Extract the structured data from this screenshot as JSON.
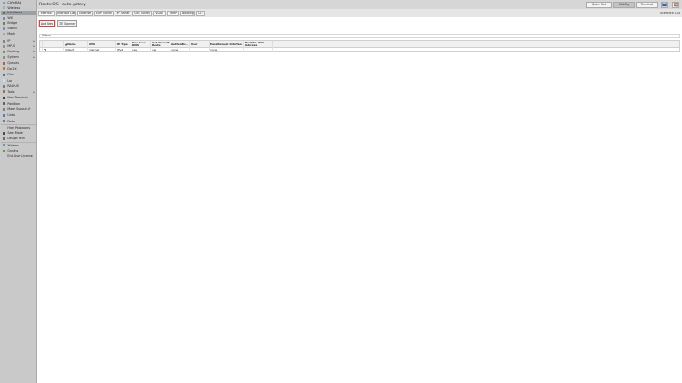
{
  "app": {
    "title": "RouterOS · auto.yotasy"
  },
  "topbar": {
    "quick_set": "Quick Set",
    "webfig": "WebFig",
    "terminal": "Terminal"
  },
  "sidebar": {
    "items": [
      {
        "label": "CAPsMAN"
      },
      {
        "label": "Wireless"
      },
      {
        "label": "Interfaces"
      },
      {
        "label": "WiFi"
      },
      {
        "label": "Bridge"
      },
      {
        "label": "Switch"
      },
      {
        "label": "Mesh"
      },
      {
        "label": "IP"
      },
      {
        "label": "MPLS"
      },
      {
        "label": "Routing"
      },
      {
        "label": "System"
      },
      {
        "label": "Queues"
      },
      {
        "label": "Dot1X"
      },
      {
        "label": "Files"
      },
      {
        "label": "Log"
      },
      {
        "label": "RADIUS"
      },
      {
        "label": "Tools"
      },
      {
        "label": "New Terminal"
      },
      {
        "label": "Partition"
      },
      {
        "label": "Make Supout.rif"
      },
      {
        "label": "Undo"
      },
      {
        "label": "Redo"
      },
      {
        "label": "Hide Passwords"
      },
      {
        "label": "Safe Mode"
      },
      {
        "label": "Design Skin"
      },
      {
        "label": "Winbox"
      },
      {
        "label": "Graphs"
      },
      {
        "label": "End-User License"
      }
    ]
  },
  "tabs": [
    "Interface",
    "Interface List",
    "Ethernet",
    "EoIP Tunnel",
    "IP Tunnel",
    "GRE Tunnel",
    "VLAN",
    "VRRP",
    "Bonding",
    "LTE"
  ],
  "section_title": "Interface List",
  "toolbar": {
    "add_new": "Add New",
    "lte_scanner": "LTE Scanner"
  },
  "items_count": "1 item",
  "table": {
    "columns": [
      "",
      "",
      "▲ Name",
      "APN",
      "IP Type",
      "Use Peer DNS",
      "Add Default Route",
      "Authentic...",
      "User",
      "Passthrough Interface",
      "Passthr. MAC Address"
    ],
    "rows": [
      [
        "",
        "",
        "default",
        "internet",
        "IPv4",
        "yes",
        "yes",
        "none",
        "",
        "none",
        ""
      ]
    ]
  },
  "colors": {
    "sidebar_bg": "#c9c9c9",
    "topbar_bg": "#d6d6d6",
    "highlight": "#d6463b"
  }
}
